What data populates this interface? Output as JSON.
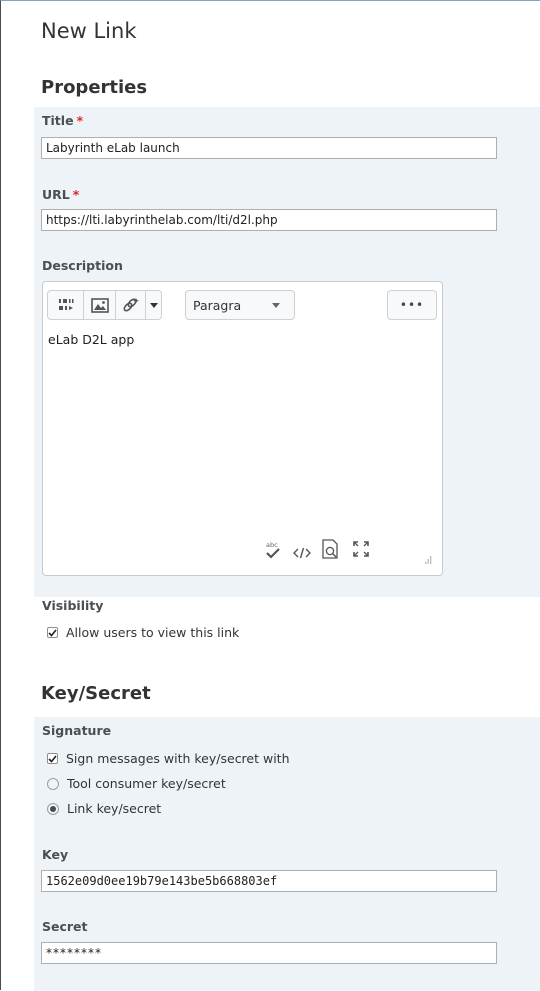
{
  "page": {
    "title": "New Link"
  },
  "properties": {
    "heading": "Properties",
    "title_field": {
      "label": "Title",
      "required_mark": "*",
      "value": "Labyrinth eLab launch"
    },
    "url_field": {
      "label": "URL",
      "required_mark": "*",
      "value": "https://lti.labyrinthelab.com/lti/d2l.php"
    },
    "description": {
      "label": "Description",
      "block_format": "Paragra",
      "content": "eLab D2L app",
      "overflow_label": "•••"
    },
    "visibility": {
      "label": "Visibility",
      "option_label": "Allow users to view this link",
      "checked": true
    }
  },
  "key_secret": {
    "heading": "Key/Secret",
    "signature": {
      "label": "Signature",
      "sign_option": {
        "label": "Sign messages with key/secret with",
        "checked": true
      },
      "radio_options": [
        {
          "label": "Tool consumer key/secret",
          "selected": false
        },
        {
          "label": "Link key/secret",
          "selected": true
        }
      ]
    },
    "key_field": {
      "label": "Key",
      "value": "1562e09d0ee19b79e143be5b668803ef"
    },
    "secret_field": {
      "label": "Secret",
      "value": "********"
    }
  },
  "colors": {
    "band_background": "#edf3f6",
    "required": "#e0262b",
    "input_border": "#aab0b5"
  }
}
